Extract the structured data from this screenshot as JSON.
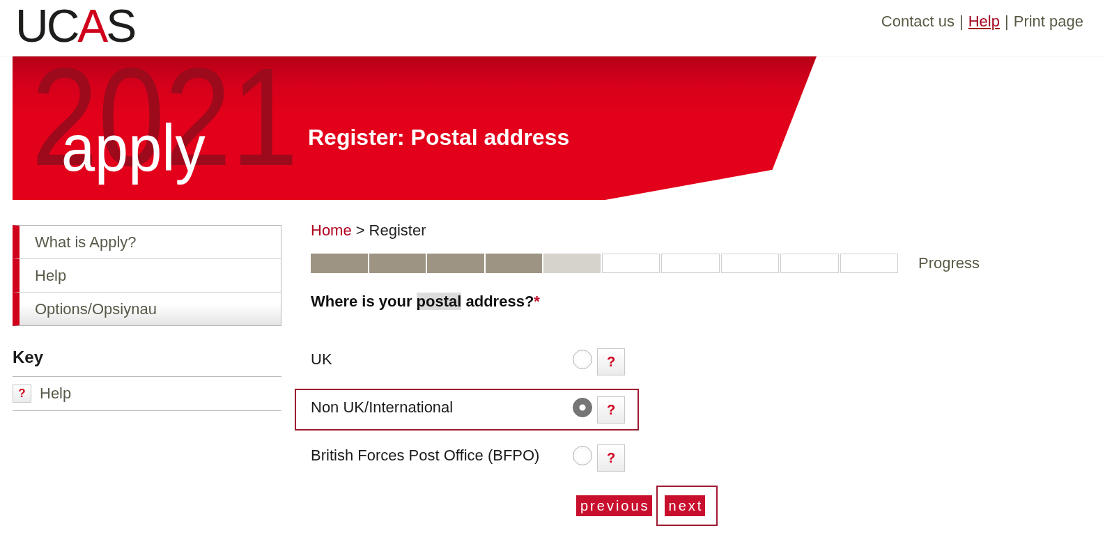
{
  "header": {
    "logo": [
      {
        "text": "UC",
        "accent": false
      },
      {
        "text": "A",
        "accent": true
      },
      {
        "text": "S",
        "accent": false
      }
    ],
    "top_links": {
      "items": [
        {
          "label": "Contact us",
          "active": false
        },
        {
          "label": "Help",
          "active": true
        },
        {
          "label": "Print page",
          "active": false
        }
      ],
      "separators": [
        "|",
        "|"
      ]
    }
  },
  "banner": {
    "year": "2021",
    "brand": "apply",
    "title": "Register: Postal address"
  },
  "sidebar": {
    "nav": [
      {
        "label": "What is Apply?",
        "hovered": false
      },
      {
        "label": "Help",
        "hovered": false
      },
      {
        "label": "Options/Opsiynau",
        "hovered": true
      }
    ],
    "key": {
      "title": "Key",
      "items": [
        {
          "symbol": "?",
          "label": "Help"
        }
      ]
    }
  },
  "breadcrumb": {
    "home": "Home",
    "separator": ">",
    "current": "Register"
  },
  "progress": {
    "steps": [
      {
        "kind": "done"
      },
      {
        "kind": "done"
      },
      {
        "kind": "done"
      },
      {
        "kind": "done"
      },
      {
        "kind": "current"
      },
      {
        "kind": "todo"
      },
      {
        "kind": "todo"
      },
      {
        "kind": "todo"
      },
      {
        "kind": "todo"
      },
      {
        "kind": "todo"
      }
    ],
    "label": "Progress"
  },
  "question": {
    "parts": [
      {
        "text": "Where is your ",
        "highlighted": false
      },
      {
        "text": "postal",
        "highlighted": true
      },
      {
        "text": " address?",
        "highlighted": false
      }
    ],
    "required_mark": "*"
  },
  "options": [
    {
      "label": "UK",
      "selected": false,
      "highlighted": false,
      "help": "?"
    },
    {
      "label": "Non UK/International",
      "selected": true,
      "highlighted": true,
      "help": "?"
    },
    {
      "label": "British Forces Post Office (BFPO)",
      "selected": false,
      "highlighted": false,
      "help": "?"
    }
  ],
  "buttons": [
    {
      "label": "previous",
      "highlighted": false
    },
    {
      "label": "next",
      "highlighted": true
    }
  ]
}
